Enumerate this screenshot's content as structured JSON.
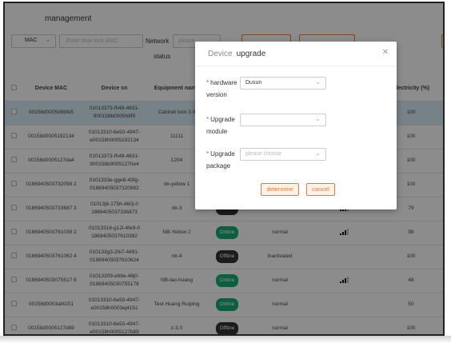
{
  "page": {
    "title": "management"
  },
  "filters": {
    "mac_select": "MAC",
    "mac_placeholder": "Enter door lock MAC",
    "network_label": "Network",
    "status_label": "status",
    "status_placeholder": "please"
  },
  "table": {
    "headers": [
      "Device MAC",
      "Device sn",
      "Equipment name",
      "",
      "",
      "",
      "Electricity (%)"
    ],
    "rows": [
      {
        "mac": "00158d0005d8bfe5",
        "sn": "01013373-fh48-4631-900158b0005h8f5",
        "name": "Cabinet lock 3.0",
        "status": "",
        "state": "",
        "signal": 0,
        "electricity": "100",
        "selected": true
      },
      {
        "mac": "00158d0005192134",
        "sn": "01013310-6e50-4947-e00158h0005192134",
        "name": "11111",
        "status": "",
        "state": "",
        "signal": 0,
        "electricity": "100",
        "selected": false
      },
      {
        "mac": "00158d0005127da4",
        "sn": "01013373-fh48-4631-900158b0005127he4",
        "name": "1204",
        "status": "",
        "state": "",
        "signal": 0,
        "electricity": "100",
        "selected": false
      },
      {
        "mac": "0186940503732099 2",
        "sn": "0101333e-gge8-43fg-01869405037320992",
        "name": "nb-yellow 1",
        "status": "",
        "state": "",
        "signal": 0,
        "electricity": "100",
        "selected": false
      },
      {
        "mac": "0186940503733687 3",
        "sn": "01013j6-175h-460j-0 1869405037336873",
        "name": "nb-3",
        "status": "Offline",
        "state": "normal",
        "signal": 3,
        "electricity": "79",
        "selected": false
      },
      {
        "mac": "0186940503761039 2",
        "sn": "01013316-g12l-4fe9-0 1869405037610392",
        "name": "NB-Yellow 2",
        "status": "Online",
        "state": "normal",
        "signal": 3,
        "electricity": "98",
        "selected": false
      },
      {
        "mac": "0186940503761062 4",
        "sn": "010133g3-2hi7-4491- 01869405037610624",
        "name": "nb-4",
        "status": "Offline",
        "state": "inactivated",
        "signal": 0,
        "electricity": "100",
        "selected": false
      },
      {
        "mac": "0186940503075517 8",
        "sn": "01013309-e69e-46j0- 01869405030755178",
        "name": "NB-lao-huang",
        "status": "Online",
        "state": "normal",
        "signal": 3,
        "electricity": "48",
        "selected": false
      },
      {
        "mac": "00158d0003af4151",
        "sn": "01013310-6e50-4947- e00158h0003ej4151",
        "name": "Test Huang Ruiping",
        "status": "Online",
        "state": "normal",
        "signal": 0,
        "electricity": "50",
        "selected": false
      },
      {
        "mac": "00158d0005127d89",
        "sn": "01013310-6e50-4947- e00158h0005127b89",
        "name": "z-3.0",
        "status": "Offline",
        "state": "normal",
        "signal": 0,
        "electricity": "100",
        "selected": false
      }
    ]
  },
  "dialog": {
    "title_prefix": "Device",
    "title": "upgrade",
    "close_icon": "close-icon",
    "hardware_label": "hardware",
    "hardware_label_2": "version",
    "hardware_value": "Dusun",
    "module_label": "Upgrade",
    "module_label_2": "module",
    "module_value": "",
    "package_label": "Upgrade",
    "package_label_2": "package",
    "package_placeholder": "please choose",
    "determine_label": "determine",
    "cancel_label": "cancel",
    "required_mark": "*",
    "chevron": "⌄"
  },
  "colors": {
    "accent": "#e07b39",
    "online": "#19a974",
    "offline": "#333333",
    "selected_row": "#d9ecf7"
  }
}
